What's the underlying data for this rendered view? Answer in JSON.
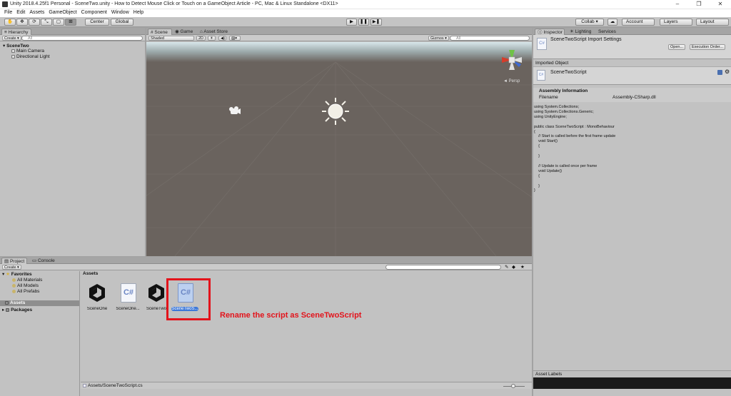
{
  "window": {
    "title": "Unity 2018.4.25f1 Personal - SceneTwo.unity - How to Detect Mouse Click or Touch on a GameObject Article - PC, Mac & Linux Standalone <DX11>",
    "minimize": "–",
    "maximize": "❐",
    "close": "✕"
  },
  "menu": [
    "File",
    "Edit",
    "Assets",
    "GameObject",
    "Component",
    "Window",
    "Help"
  ],
  "toolbar": {
    "tools": [
      "hand-tool-icon",
      "move-tool-icon",
      "rotate-tool-icon",
      "scale-tool-icon",
      "rect-tool-icon",
      "transform-tool-icon"
    ],
    "pivot": "Center",
    "space": "Global",
    "play": "▶",
    "pause": "❚❚",
    "step": "▶❚",
    "collab": "Collab ▾",
    "account": "Account",
    "layers": "Layers",
    "layout": "Layout"
  },
  "hierarchy": {
    "tab": "Hierarchy",
    "create": "Create ▾",
    "search_placeholder": "All",
    "scene": "SceneTwo",
    "items": [
      "Main Camera",
      "Directional Light"
    ]
  },
  "scene_view": {
    "tabs": [
      "Scene",
      "Game",
      "Asset Store"
    ],
    "shading": "Shaded",
    "mode_2d": "2D",
    "gizmos": "Gizmos ▾",
    "search_placeholder": "All",
    "persp": "◄ Persp",
    "background": "#6a635e",
    "sky_top": "#d8e6ea"
  },
  "inspector": {
    "tabs": [
      "Inspector",
      "Lighting",
      "Services"
    ],
    "title": "SceneTwoScript Import Settings",
    "open_btn": "Open...",
    "exec_btn": "Execution Order...",
    "imported_object": "Imported Object",
    "object_name": "SceneTwoScript",
    "assembly_header": "Assembly Information",
    "filename_label": "Filename",
    "filename_value": "Assembly-CSharp.dll",
    "code": [
      "using System.Collections;",
      "using System.Collections.Generic;",
      "using UnityEngine;",
      "",
      "public class SceneTwoScript : MonoBehaviour",
      "{",
      "    // Start is called before the first frame update",
      "    void Start()",
      "    {",
      "",
      "    }",
      "",
      "    // Update is called once per frame",
      "    void Update()",
      "    {",
      "",
      "    }",
      "}"
    ],
    "asset_labels": "Asset Labels"
  },
  "project": {
    "tabs": [
      "Project",
      "Console"
    ],
    "create": "Create ▾",
    "favorites": "Favorites",
    "favorite_items": [
      "All Materials",
      "All Models",
      "All Prefabs"
    ],
    "assets_folder": "Assets",
    "packages_folder": "Packages",
    "breadcrumb": "Assets",
    "assets": [
      {
        "name": "SceneOne",
        "kind": "unity"
      },
      {
        "name": "SceneOne...",
        "kind": "cs"
      },
      {
        "name": "SceneTwo",
        "kind": "unity"
      },
      {
        "name": "SceneTwoS...",
        "kind": "cs"
      }
    ],
    "path": "Assets/SceneTwoScript.cs"
  },
  "annotation": {
    "text": "Rename the script as SceneTwoScript",
    "color": "#e3131b"
  }
}
